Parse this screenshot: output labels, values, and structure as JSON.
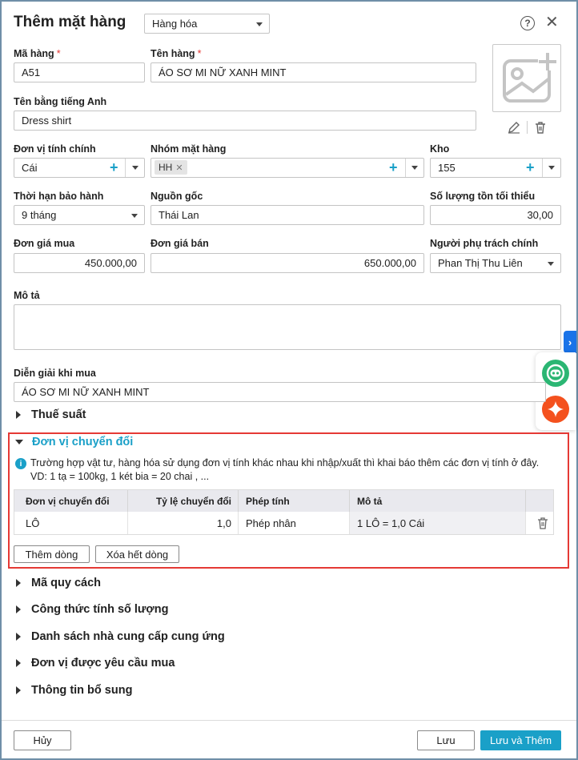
{
  "dialog": {
    "title": "Thêm mặt hàng",
    "type_select": "Hàng hóa",
    "help_icon": "question-circle-icon",
    "close_icon": "close-icon"
  },
  "fields": {
    "code": {
      "label": "Mã hàng",
      "required": "*",
      "value": "A51"
    },
    "name": {
      "label": "Tên hàng",
      "required": "*",
      "value": "ÁO SƠ MI NỮ XANH MINT"
    },
    "english_name": {
      "label": "Tên bằng tiếng Anh",
      "value": "Dress shirt"
    },
    "main_unit": {
      "label": "Đơn vị tính chính",
      "value": "Cái"
    },
    "item_group": {
      "label": "Nhóm mặt hàng",
      "tag": "HH",
      "tag_remove": "✕"
    },
    "warehouse": {
      "label": "Kho",
      "value": "155"
    },
    "warranty": {
      "label": "Thời hạn bảo hành",
      "value": "9 tháng"
    },
    "origin": {
      "label": "Nguồn gốc",
      "value": "Thái Lan"
    },
    "min_stock": {
      "label": "Số lượng tồn tối thiểu",
      "value": "30,00"
    },
    "purchase_price": {
      "label": "Đơn giá mua",
      "value": "450.000,00"
    },
    "sale_price": {
      "label": "Đơn giá bán",
      "value": "650.000,00"
    },
    "manager": {
      "label": "Người phụ trách chính",
      "value": "Phan Thị Thu Liên"
    },
    "description": {
      "label": "Mô tả",
      "value": ""
    },
    "purchase_note": {
      "label": "Diễn giải khi mua",
      "value": "ÁO SƠ MI NỮ XANH MINT"
    }
  },
  "sections": {
    "tax": "Thuế suất",
    "conversion": "Đơn vị chuyển đổi",
    "spec": "Mã quy cách",
    "qty_formula": "Công thức tính số lượng",
    "suppliers": "Danh sách nhà cung cấp cung ứng",
    "requesting_units": "Đơn vị được yêu cầu mua",
    "extra_info": "Thông tin bổ sung"
  },
  "conversion": {
    "info_text": "Trường hợp vật tư, hàng hóa sử dụng đơn vị tính khác nhau khi nhập/xuất thì khai báo thêm các đơn vị tính ở đây. VD: 1 tạ = 100kg, 1 két bia = 20 chai , ...",
    "columns": [
      "Đơn vị chuyển đổi",
      "Tỷ lệ chuyển đổi",
      "Phép tính",
      "Mô tả"
    ],
    "rows": [
      {
        "unit": "LÔ",
        "ratio": "1,0",
        "operation": "Phép nhân",
        "description": "1 LÔ = 1,0 Cái"
      }
    ],
    "add_row": "Thêm dòng",
    "clear_rows": "Xóa hết dòng"
  },
  "footer": {
    "cancel": "Hủy",
    "save": "Lưu",
    "save_and_add": "Lưu và Thêm"
  },
  "colors": {
    "accent": "#1aa0c8",
    "highlight_border": "#e53935",
    "fab_chat": "#2bb673",
    "fab_ai": "#f4511e"
  }
}
